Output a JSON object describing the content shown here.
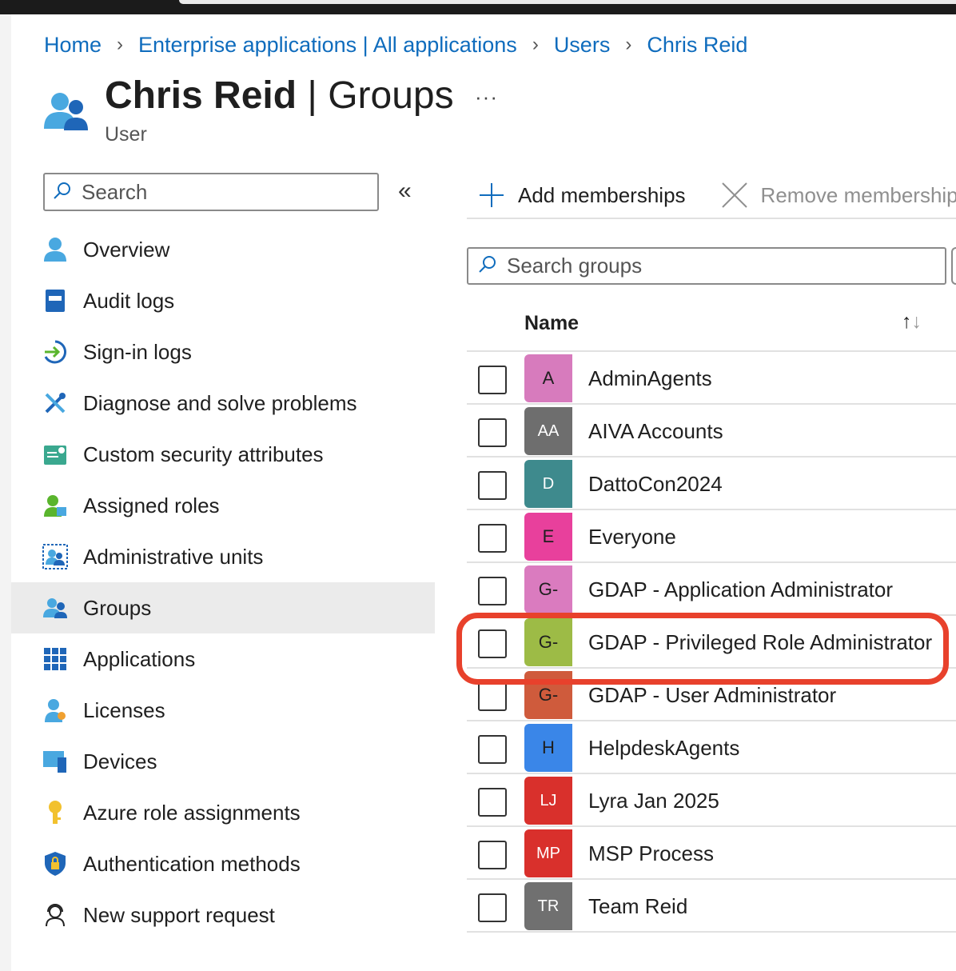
{
  "breadcrumb": [
    {
      "label": "Home"
    },
    {
      "label": "Enterprise applications | All applications"
    },
    {
      "label": "Users"
    },
    {
      "label": "Chris Reid"
    }
  ],
  "header": {
    "name": "Chris Reid",
    "separator": "|",
    "page": "Groups",
    "more": "···",
    "subtitle": "User"
  },
  "sidebar": {
    "search_placeholder": "Search",
    "collapse_glyph": "«",
    "items": [
      {
        "label": "Overview",
        "icon": "user-icon"
      },
      {
        "label": "Audit logs",
        "icon": "audit-log-icon"
      },
      {
        "label": "Sign-in logs",
        "icon": "sign-in-icon"
      },
      {
        "label": "Diagnose and solve problems",
        "icon": "wrench-icon"
      },
      {
        "label": "Custom security attributes",
        "icon": "attributes-icon"
      },
      {
        "label": "Assigned roles",
        "icon": "assigned-roles-icon"
      },
      {
        "label": "Administrative units",
        "icon": "admin-units-icon"
      },
      {
        "label": "Groups",
        "icon": "groups-icon",
        "active": true
      },
      {
        "label": "Applications",
        "icon": "applications-grid-icon"
      },
      {
        "label": "Licenses",
        "icon": "license-icon"
      },
      {
        "label": "Devices",
        "icon": "devices-icon"
      },
      {
        "label": "Azure role assignments",
        "icon": "key-icon"
      },
      {
        "label": "Authentication methods",
        "icon": "shield-lock-icon"
      },
      {
        "label": "New support request",
        "icon": "support-icon"
      }
    ]
  },
  "toolbar": {
    "add_label": "Add memberships",
    "remove_label": "Remove memberships"
  },
  "groups_search": {
    "placeholder": "Search groups"
  },
  "table": {
    "column_name": "Name",
    "sort_glyph_up": "↑",
    "sort_glyph_down": "↓",
    "rows": [
      {
        "initials": "A",
        "name": "AdminAgents",
        "color": "#d77bbd",
        "dark": true
      },
      {
        "initials": "AA",
        "name": "AIVA Accounts",
        "color": "#6e6e6e",
        "dark": false
      },
      {
        "initials": "D",
        "name": "DattoCon2024",
        "color": "#3e8a8d",
        "dark": false
      },
      {
        "initials": "E",
        "name": "Everyone",
        "color": "#e8409c",
        "dark": true
      },
      {
        "initials": "G-",
        "name": "GDAP - Application Administrator",
        "color": "#da7bbf",
        "dark": true
      },
      {
        "initials": "G-",
        "name": "GDAP - Privileged Role Administrator",
        "color": "#9dbb46",
        "dark": true
      },
      {
        "initials": "G-",
        "name": "GDAP - User Administrator",
        "color": "#cf5b3c",
        "dark": true
      },
      {
        "initials": "H",
        "name": "HelpdeskAgents",
        "color": "#3a86e8",
        "dark": true
      },
      {
        "initials": "LJ",
        "name": "Lyra Jan 2025",
        "color": "#d9302c",
        "dark": false
      },
      {
        "initials": "MP",
        "name": "MSP Process",
        "color": "#d9302c",
        "dark": false
      },
      {
        "initials": "TR",
        "name": "Team Reid",
        "color": "#707070",
        "dark": false
      }
    ]
  },
  "highlight": {
    "row": "GDAP - Privileged Role Administrator",
    "color": "#e8412c"
  }
}
